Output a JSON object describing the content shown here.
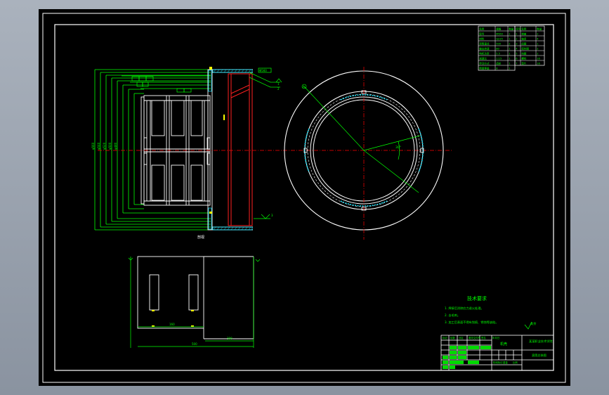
{
  "drawing": {
    "section_label": "剖视",
    "tech_req": {
      "title": "技术要求",
      "items": [
        "1. 焊接后消除应力退火处理。",
        "2. 去毛刺。",
        "3. 加工后表面不得有划痕、锈蚀等缺陷。"
      ]
    },
    "roughness_note": "其余",
    "title_block": {
      "school": "某某职业技术学院",
      "part_name": "机壳",
      "drawing_no": "滚筒总装图",
      "row_labels": [
        "标记",
        "处数",
        "分区",
        "更改文件号",
        "签名",
        "年月日"
      ],
      "stage_labels": [
        "阶段标记",
        "重量",
        "比例"
      ]
    },
    "spec_table_a": {
      "rows": [
        [
          "名称",
          "规格",
          "数量"
        ],
        [
          "型号",
          "Φ560",
          "1"
        ],
        [
          "材料",
          "Q235",
          "1"
        ],
        [
          "滚筒直径",
          "500",
          "2"
        ],
        [
          "输出转速",
          "80",
          "1"
        ],
        [
          "电机功率",
          "5.5",
          "1"
        ],
        [
          "减速比",
          "1:15",
          "1"
        ],
        [
          "传动方式",
          "齿轮",
          "1"
        ],
        [
          "精度等级",
          "8",
          "1"
        ]
      ]
    },
    "spec_table_b": {
      "rows": [
        [
          "序号",
          "名称",
          "数量"
        ],
        [
          "1",
          "端盖",
          "2"
        ],
        [
          "2",
          "轴承",
          "4"
        ],
        [
          "3",
          "齿圈",
          "1"
        ],
        [
          "4",
          "密封圈",
          "2"
        ],
        [
          "5",
          "挡圈",
          "2"
        ],
        [
          "6",
          "螺栓",
          "16"
        ],
        [
          "7",
          "垫片",
          "16"
        ]
      ]
    },
    "dims": {
      "angle": "30°",
      "balloon": "A"
    },
    "colors": {
      "frame": "#ffffff",
      "outline": "#ffffff",
      "dimension": "#00ff00",
      "centerline": "#ff0000",
      "section": "#ff2020",
      "hatch": "#00ffff",
      "accent": "#ffff00"
    }
  }
}
